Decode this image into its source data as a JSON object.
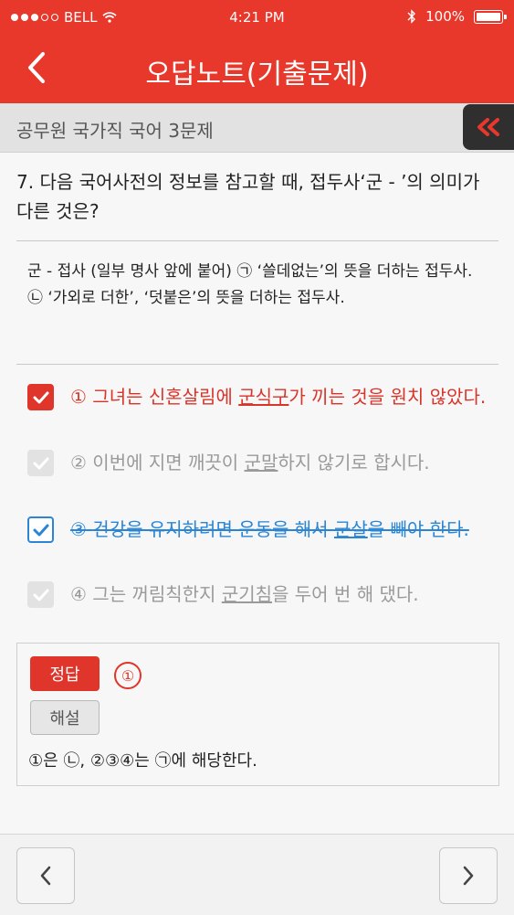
{
  "status": {
    "carrier": "BELL",
    "time": "4:21 PM",
    "battery": "100%"
  },
  "header": {
    "title": "오답노트(기출문제)"
  },
  "subheader": {
    "text": "공무원 국가직 국어 3문제"
  },
  "question": {
    "text": "7. 다음 국어사전의 정보를 참고할 때, 접두사‘군 - ’의 의미가 다른 것은?"
  },
  "definition": {
    "text": "군 -  접사 (일부 명사 앞에 붙어) ㉠ ‘쓸데없는’의 뜻을 더하는 접두사. ㉡ ‘가외로 더한’, ‘덧붙은’의 뜻을 더하는 접두사."
  },
  "options": [
    {
      "num": "①",
      "before": "그녀는 신혼살림에 ",
      "underlined": "군식구",
      "after": "가 끼는 것을 원치 않았다.",
      "state": "selected-wrong",
      "color": "#d8342a"
    },
    {
      "num": "②",
      "before": "이번에 지면 깨끗이 ",
      "underlined": "군말",
      "after": "하지 않기로 합시다.",
      "state": "disabled",
      "color": "#9a9a9a"
    },
    {
      "num": "③",
      "before": "건강을 유지하려면 운동을 해서 ",
      "underlined": "군살",
      "after": "을 빼야 한다.",
      "state": "crossed",
      "color": "#2b85d3"
    },
    {
      "num": "④",
      "before": "그는 꺼림칙한지 ",
      "underlined": "군기침",
      "after": "을 두어 번 해 댔다.",
      "state": "disabled",
      "color": "#9a9a9a"
    }
  ],
  "answer": {
    "label": "정답",
    "value": "①",
    "explain_label": "해설",
    "explanation": "①은 ㉡, ②③④는 ㉠에 해당한다."
  },
  "colors": {
    "accent": "#e8372b",
    "blue": "#2b85d3"
  }
}
